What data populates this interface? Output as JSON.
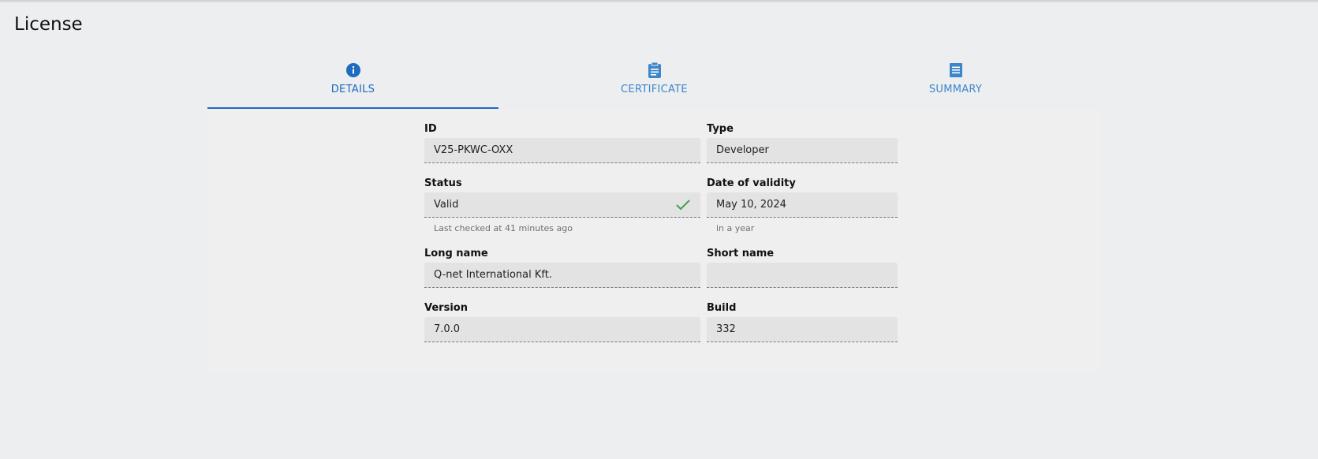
{
  "page": {
    "title": "License"
  },
  "tabs": [
    {
      "label": "DETAILS",
      "icon": "info-icon",
      "active": true
    },
    {
      "label": "CERTIFICATE",
      "icon": "clipboard-icon",
      "active": false
    },
    {
      "label": "SUMMARY",
      "icon": "document-icon",
      "active": false
    }
  ],
  "accent_color": "#1f6bbf",
  "success_color": "#43a047",
  "fields": {
    "id": {
      "label": "ID",
      "value": "V25-PKWC-OXX"
    },
    "type": {
      "label": "Type",
      "value": "Developer"
    },
    "status": {
      "label": "Status",
      "value": "Valid",
      "hint": "Last checked at 41 minutes ago",
      "icon": "check-icon"
    },
    "validity": {
      "label": "Date of validity",
      "value": "May 10, 2024",
      "hint": "in a year"
    },
    "long_name": {
      "label": "Long name",
      "value": "Q-net International Kft."
    },
    "short_name": {
      "label": "Short name",
      "value": ""
    },
    "version": {
      "label": "Version",
      "value": "7.0.0"
    },
    "build": {
      "label": "Build",
      "value": "332"
    }
  }
}
